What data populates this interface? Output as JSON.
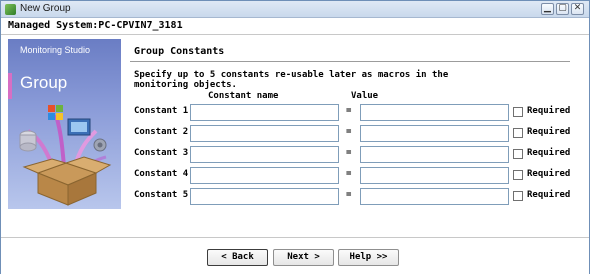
{
  "window": {
    "title": "New Group",
    "controls": [
      "minimize",
      "maximize",
      "close"
    ]
  },
  "system": {
    "label": "Managed System:PC-CPVIN7_3181"
  },
  "banner": {
    "brand": "Monitoring Studio",
    "title": "Group"
  },
  "section": {
    "title": "Group Constants",
    "instructions": "Specify up to 5 constants re-usable later as macros in the monitoring objects.",
    "col_name": "Constant name",
    "col_value": "Value"
  },
  "constants": [
    {
      "label": "Constant 1:",
      "name": "",
      "value": "",
      "required_label": "Required",
      "required": false
    },
    {
      "label": "Constant 2:",
      "name": "",
      "value": "",
      "required_label": "Required",
      "required": false
    },
    {
      "label": "Constant 3:",
      "name": "",
      "value": "",
      "required_label": "Required",
      "required": false
    },
    {
      "label": "Constant 4:",
      "name": "",
      "value": "",
      "required_label": "Required",
      "required": false
    },
    {
      "label": "Constant 5:",
      "name": "",
      "value": "",
      "required_label": "Required",
      "required": false
    }
  ],
  "equals_sign": "=",
  "buttons": {
    "back": "< Back",
    "next": "Next >",
    "help": "Help >>"
  }
}
